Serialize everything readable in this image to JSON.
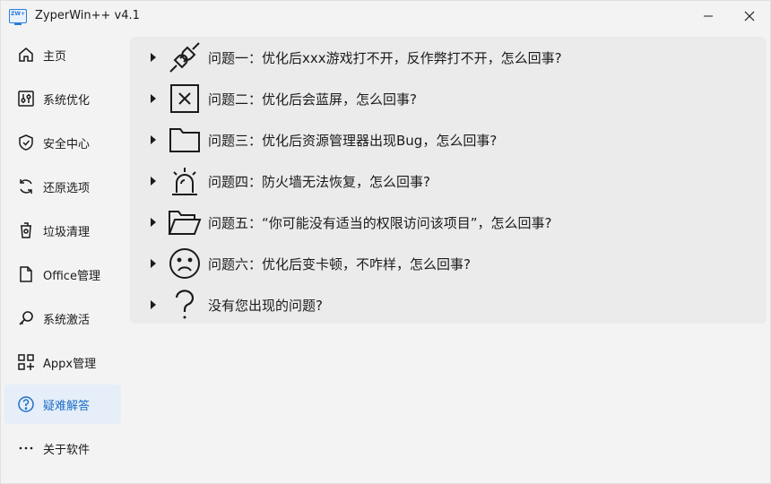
{
  "window": {
    "title": "ZyperWin++ v4.1",
    "icon_text": "ZW+"
  },
  "colors": {
    "accent": "#1f6fc5",
    "active_bg": "#e5eef9",
    "panel_bg": "#ebebeb",
    "window_bg": "#f3f3f3"
  },
  "sidebar": {
    "items": [
      {
        "label": "主页",
        "icon": "home-icon"
      },
      {
        "label": "系统优化",
        "icon": "sliders-icon"
      },
      {
        "label": "安全中心",
        "icon": "shield-icon"
      },
      {
        "label": "还原选项",
        "icon": "restore-icon"
      },
      {
        "label": "垃圾清理",
        "icon": "trash-icon"
      },
      {
        "label": "Office管理",
        "icon": "document-icon"
      },
      {
        "label": "系统激活",
        "icon": "key-icon"
      },
      {
        "label": "Appx管理",
        "icon": "apps-icon"
      },
      {
        "label": "疑难解答",
        "icon": "help-circle-icon",
        "active": true
      },
      {
        "label": "关于软件",
        "icon": "more-icon"
      }
    ]
  },
  "faq": {
    "items": [
      {
        "label": "问题一：优化后xxx游戏打不开，反作弊打不开，怎么回事?",
        "icon": "plug-icon"
      },
      {
        "label": "问题二：优化后会蓝屏，怎么回事?",
        "icon": "x-box-icon"
      },
      {
        "label": "问题三：优化后资源管理器出现Bug，怎么回事?",
        "icon": "folder-icon"
      },
      {
        "label": "问题四：防火墙无法恢复，怎么回事?",
        "icon": "siren-icon"
      },
      {
        "label": "问题五：“你可能没有适当的权限访问该项目”，怎么回事?",
        "icon": "folder-open-icon"
      },
      {
        "label": "问题六：优化后变卡顿，不咋样，怎么回事?",
        "icon": "sad-face-icon"
      },
      {
        "label": "没有您出现的问题?",
        "icon": "question-mark-icon"
      }
    ]
  }
}
